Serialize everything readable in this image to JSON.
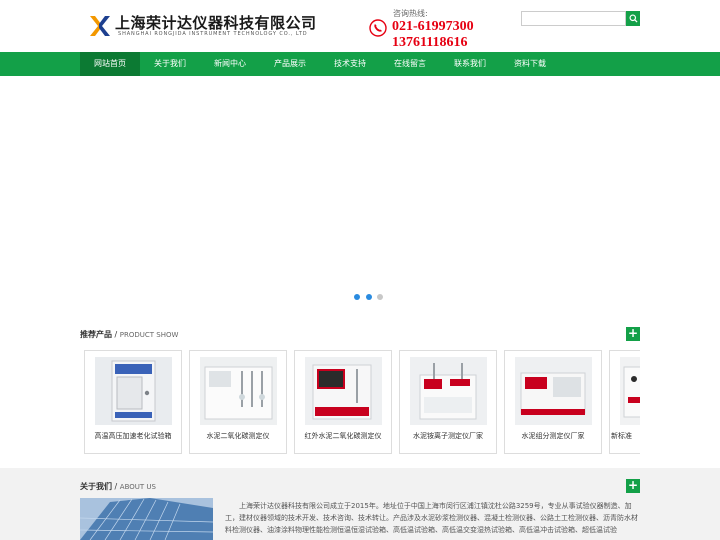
{
  "header": {
    "company_cn": "上海荣计达仪器科技有限公司",
    "company_en": "SHANGHAI RONGJIDA INSTRUMENT TECHNOLOGY CO., LTD",
    "hotline_label": "咨询热线:",
    "phone1": "021-61997300",
    "phone2": "13761118616",
    "search_placeholder": ""
  },
  "nav": {
    "items": [
      {
        "label": "网站首页"
      },
      {
        "label": "关于我们"
      },
      {
        "label": "新闻中心"
      },
      {
        "label": "产品展示"
      },
      {
        "label": "技术支持"
      },
      {
        "label": "在线留言"
      },
      {
        "label": "联系我们"
      },
      {
        "label": "资料下载"
      }
    ]
  },
  "products": {
    "title_cn": "推荐产品",
    "sep": " / ",
    "title_en": "PRODUCT SHOW",
    "more": "+",
    "items": [
      {
        "label": "高温高压加速老化试验箱"
      },
      {
        "label": "水泥二氧化碳测定仪"
      },
      {
        "label": "红外水泥二氧化碳测定仪"
      },
      {
        "label": "水泥铵离子测定仪厂家"
      },
      {
        "label": "水泥组分测定仪厂家"
      },
      {
        "label": "新标准"
      }
    ]
  },
  "about": {
    "title_cn": "关于我们",
    "sep": " / ",
    "title_en": "ABOUT US",
    "more": "+",
    "text": "上海荣计达仪器科技有限公司成立于2015年。地址位于中国上海市闵行区浦江镇沈杜公路3259号，专业从事试验仪器制造、加工，建材仪器领域的技术开发、技术咨询、技术转让。产品涉及水泥砂浆检测仪器、混凝土检测仪器、公路土工检测仪器、沥青防水材料检测仪器、油漆涂料物理性能检测恒温恒湿试验箱、高低温试验箱、高低温交变湿热试验箱、高低温冲击试验箱、超低温试验"
  },
  "colors": {
    "brand_green": "#13a048",
    "active_green": "#0c7a33",
    "phone_red": "#e60012"
  }
}
